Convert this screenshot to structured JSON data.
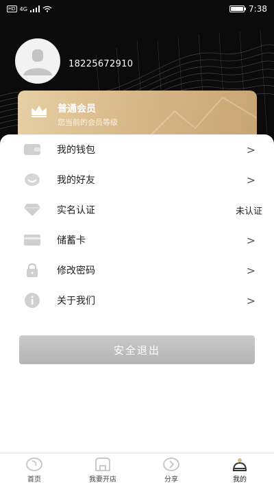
{
  "status_bar": {
    "network": "4G",
    "time": "7:38"
  },
  "profile": {
    "phone": "18225672910",
    "avatar": "default-avatar-icon"
  },
  "membership": {
    "title": "普通会员",
    "subtitle": "您当前的会员等级",
    "icon": "crown-icon"
  },
  "menu": [
    {
      "label": "我的钱包",
      "icon": "wallet-icon",
      "chevron": ">"
    },
    {
      "label": "我的好友",
      "icon": "smile-icon",
      "chevron": ">"
    },
    {
      "label": "实名认证",
      "icon": "diamond-icon",
      "status": "未认证"
    },
    {
      "label": "储蓄卡",
      "icon": "card-icon",
      "chevron": ">"
    },
    {
      "label": "修改密码",
      "icon": "lock-icon",
      "chevron": ">"
    },
    {
      "label": "关于我们",
      "icon": "info-icon",
      "chevron": ">"
    }
  ],
  "logout_label": "安全退出",
  "nav": [
    {
      "label": "首页",
      "icon": "home-icon"
    },
    {
      "label": "我要开店",
      "icon": "store-icon"
    },
    {
      "label": "分享",
      "icon": "share-icon"
    },
    {
      "label": "我的",
      "icon": "profile-icon",
      "active": true
    }
  ],
  "colors": {
    "gold": "#d8b98a",
    "header_bg": "#0b0b0b",
    "logout_bg": "#bdbdbd"
  }
}
